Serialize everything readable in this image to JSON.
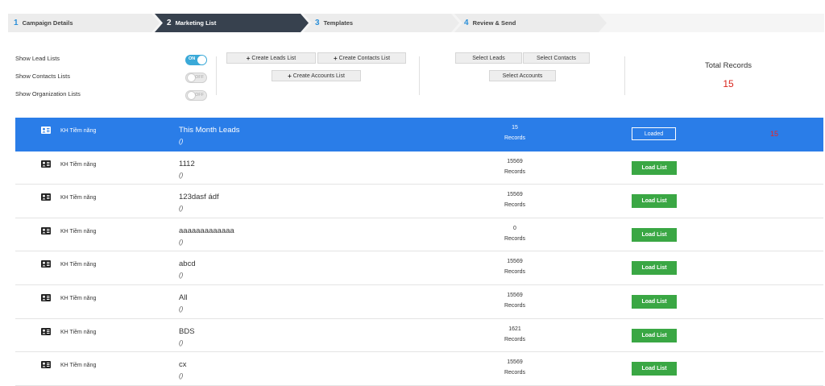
{
  "wizard": {
    "steps": [
      {
        "num": "1",
        "label": "Campaign Details"
      },
      {
        "num": "2",
        "label": "Marketing List"
      },
      {
        "num": "3",
        "label": "Templates"
      },
      {
        "num": "4",
        "label": "Review & Send"
      }
    ],
    "active_step": 2
  },
  "toggles": [
    {
      "label": "Show Lead Lists",
      "state": "ON"
    },
    {
      "label": "Show Contacts Lists",
      "state": "OFF"
    },
    {
      "label": "Show Organization Lists",
      "state": "OFF"
    }
  ],
  "create_buttons": {
    "leads": "Create Leads List",
    "contacts": "Create Contacts List",
    "accounts": "Create Accounts List"
  },
  "select_buttons": {
    "leads": "Select Leads",
    "contacts": "Select Contacts",
    "accounts": "Select Accounts"
  },
  "total": {
    "title": "Total Records",
    "value": "15"
  },
  "rows": [
    {
      "type": "KH Tiềm năng",
      "name": "This Month Leads",
      "desc": "()",
      "count": "15",
      "records": "Records",
      "action": "Loaded",
      "row_total": "15"
    },
    {
      "type": "KH Tiềm năng",
      "name": "1112",
      "desc": "()",
      "count": "15569",
      "records": "Records",
      "action": "Load List"
    },
    {
      "type": "KH Tiềm năng",
      "name": "123dasf ádf",
      "desc": "()",
      "count": "15569",
      "records": "Records",
      "action": "Load List"
    },
    {
      "type": "KH Tiềm năng",
      "name": "aaaaaaaaaaaaa",
      "desc": "()",
      "count": "0",
      "records": "Records",
      "action": "Load List"
    },
    {
      "type": "KH Tiềm năng",
      "name": "abcd",
      "desc": "()",
      "count": "15569",
      "records": "Records",
      "action": "Load List"
    },
    {
      "type": "KH Tiềm năng",
      "name": "All",
      "desc": "()",
      "count": "15569",
      "records": "Records",
      "action": "Load List"
    },
    {
      "type": "KH Tiềm năng",
      "name": "BDS",
      "desc": "()",
      "count": "1621",
      "records": "Records",
      "action": "Load List"
    },
    {
      "type": "KH Tiềm năng",
      "name": "cx",
      "desc": "()",
      "count": "15569",
      "records": "Records",
      "action": "Load List"
    }
  ],
  "colors": {
    "accent": "#2b8fd8",
    "selected_row": "#2a7de8",
    "active_step": "#37414e",
    "load_button": "#3aa744",
    "total_value": "#d9251c"
  }
}
